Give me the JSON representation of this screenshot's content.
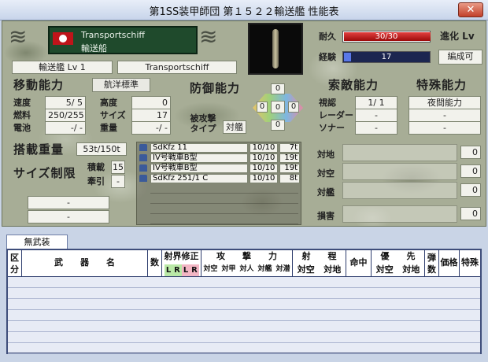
{
  "window": {
    "title": "第1SS装甲師団 第１５２２輸送艦 性能表",
    "close_label": "✕"
  },
  "ship": {
    "name_en": "Transportschiff",
    "name_jp": "輸送船",
    "type_level": "輸送艦 Lv 1",
    "class_name": "Transportschiff",
    "flag": "swastika-flag"
  },
  "status": {
    "durability_label": "耐久",
    "durability_value": "30/30",
    "durability_fill": 1.0,
    "exp_label": "経験",
    "exp_value": "17",
    "exp_fill": 0.08,
    "evolve_label": "進化 Lv",
    "evolve_value": "編成可"
  },
  "movement": {
    "header": "移動能力",
    "mode_button": "航洋標準",
    "stats": [
      {
        "label": "速度",
        "value": "5/ 5"
      },
      {
        "label": "燃料",
        "value": "250/255"
      },
      {
        "label": "電池",
        "value": "-/ -"
      }
    ],
    "stats2": [
      {
        "label": "高度",
        "value": "0"
      },
      {
        "label": "サイズ",
        "value": "17"
      },
      {
        "label": "重量",
        "value": "-/ -"
      }
    ]
  },
  "defense": {
    "header": "防御能力",
    "top": "0",
    "left": "0",
    "center": "0",
    "right": "0",
    "bottom": "0",
    "attacked_type_label": "被攻撃タイプ",
    "attacked_type_value": "対艦"
  },
  "detection": {
    "header": "索敵能力",
    "items": [
      {
        "label": "視認",
        "value": "1/ 1"
      },
      {
        "label": "レーダー",
        "value": "-"
      },
      {
        "label": "ソナー",
        "value": "-"
      }
    ]
  },
  "special": {
    "header": "特殊能力",
    "items": [
      "夜間能力",
      "-",
      "-"
    ]
  },
  "cargo": {
    "header": "搭載重量",
    "weight": "53t/150t",
    "size_limit_label": "サイズ制限",
    "load_label": "積載",
    "load_value": "15",
    "tow_label": "牽引",
    "tow_value": "-",
    "extra1": "-",
    "extra2": "-",
    "items": [
      {
        "name": "SdKfz 11",
        "status": "10/10",
        "weight": "7t"
      },
      {
        "name": "IV号戦車B型",
        "status": "10/10",
        "weight": "19t"
      },
      {
        "name": "IV号戦車B型",
        "status": "10/10",
        "weight": "19t"
      },
      {
        "name": "SdKfz 251/1 C",
        "status": "10/10",
        "weight": "8t"
      }
    ]
  },
  "attack": {
    "items": [
      {
        "label": "対地",
        "value": "0"
      },
      {
        "label": "対空",
        "value": "0"
      },
      {
        "label": "対艦",
        "value": "0"
      }
    ],
    "damage_label": "損害",
    "damage_value": "0"
  },
  "weapons": {
    "tab": "無武装",
    "headers": {
      "div": "区分",
      "weapon": "武　　器　　名",
      "count": "数",
      "accuracy": "射界修正",
      "attack": "攻　　撃　　力",
      "range": "射　　程",
      "hit": "命中",
      "priority": "優　　先",
      "ammo": "弾数",
      "price": "価格",
      "special": "特殊"
    },
    "lr": [
      "L",
      "R",
      "L",
      "R"
    ],
    "attack_sub": [
      "対空",
      "対甲",
      "対人",
      "対艦",
      "対潜"
    ],
    "range_sub": [
      "対空",
      "対地"
    ],
    "priority_sub": [
      "対空",
      "対地"
    ]
  }
}
